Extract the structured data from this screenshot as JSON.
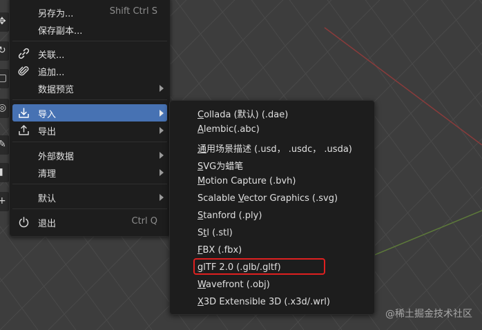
{
  "file_menu": {
    "items": [
      {
        "label": "另存为...",
        "shortcut": "Shift Ctrl S",
        "icon": "none"
      },
      {
        "label": "保存副本...",
        "shortcut": "",
        "icon": "none"
      },
      {
        "label": "关联...",
        "shortcut": "",
        "icon": "link-icon"
      },
      {
        "label": "追加...",
        "shortcut": "",
        "icon": "paperclip-icon"
      },
      {
        "label": "数据预览",
        "shortcut": "",
        "icon": "none",
        "submenu": true
      },
      {
        "label": "导入",
        "shortcut": "",
        "icon": "import-icon",
        "submenu": true,
        "active": true
      },
      {
        "label": "导出",
        "shortcut": "",
        "icon": "export-icon",
        "submenu": true
      },
      {
        "label": "外部数据",
        "shortcut": "",
        "icon": "none",
        "submenu": true
      },
      {
        "label": "清理",
        "shortcut": "",
        "icon": "none",
        "submenu": true
      },
      {
        "label": "默认",
        "shortcut": "",
        "icon": "none",
        "submenu": true
      },
      {
        "label": "退出",
        "shortcut": "Ctrl Q",
        "icon": "power-icon"
      }
    ]
  },
  "import_menu": {
    "items": [
      {
        "pre": "",
        "ul": "C",
        "post": "ollada (默认) (.dae)"
      },
      {
        "pre": "",
        "ul": "A",
        "post": "lembic(.abc)"
      },
      {
        "pre": "",
        "ul": "通",
        "post": "用场景描述 (.usd， .usdc， .usda)"
      },
      {
        "pre": "",
        "ul": "S",
        "post": "VG为蜡笔"
      },
      {
        "pre": "",
        "ul": "M",
        "post": "otion Capture (.bvh)"
      },
      {
        "pre": "Scalable ",
        "ul": "V",
        "post": "ector Graphics (.svg)"
      },
      {
        "pre": "",
        "ul": "S",
        "post": "tanford (.ply)"
      },
      {
        "pre": "S",
        "ul": "t",
        "post": "l (.stl)"
      },
      {
        "pre": "",
        "ul": "F",
        "post": "BX (.fbx)"
      },
      {
        "pre": "",
        "ul": "g",
        "post": "lTF 2.0 (.glb/.gltf)",
        "highlighted": true
      },
      {
        "pre": "",
        "ul": "W",
        "post": "avefront (.obj)"
      },
      {
        "pre": "",
        "ul": "X",
        "post": "3D Extensible 3D (.x3d/.wrl)"
      }
    ]
  },
  "watermark": "@稀土掘金技术社区",
  "colors": {
    "menu_bg": "#1d1d1d",
    "active_bg": "#4772b3",
    "highlight_border": "#e02020",
    "viewport_bg": "#3d3d3d"
  }
}
